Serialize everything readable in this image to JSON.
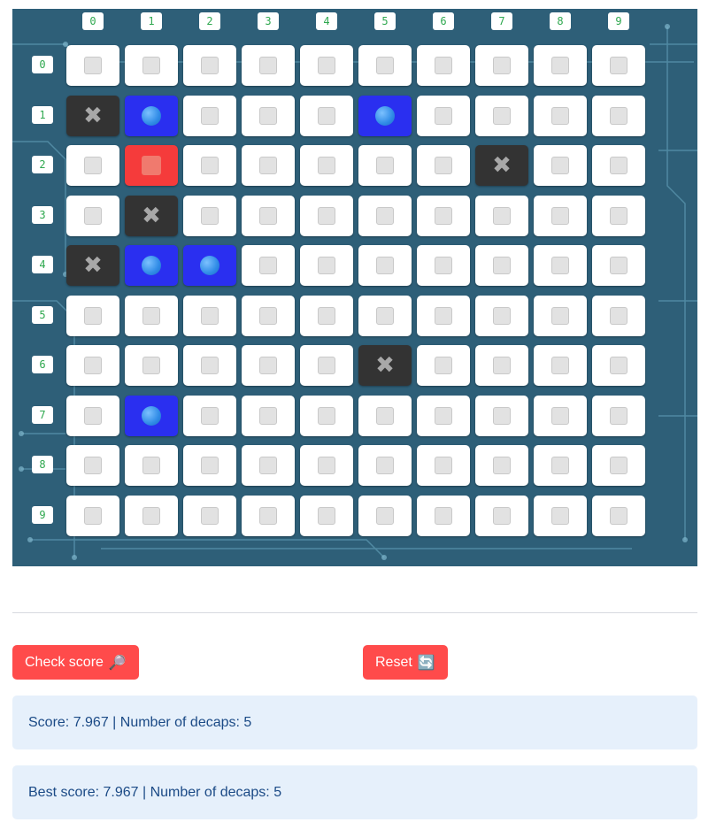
{
  "grid": {
    "columns": [
      "0",
      "1",
      "2",
      "3",
      "4",
      "5",
      "6",
      "7",
      "8",
      "9"
    ],
    "rows": [
      "0",
      "1",
      "2",
      "3",
      "4",
      "5",
      "6",
      "7",
      "8",
      "9"
    ],
    "cells": [
      [
        "empty",
        "empty",
        "empty",
        "empty",
        "empty",
        "empty",
        "empty",
        "empty",
        "empty",
        "empty"
      ],
      [
        "blocked",
        "decap",
        "empty",
        "empty",
        "empty",
        "decap",
        "empty",
        "empty",
        "empty",
        "empty"
      ],
      [
        "empty",
        "target",
        "empty",
        "empty",
        "empty",
        "empty",
        "empty",
        "blocked",
        "empty",
        "empty"
      ],
      [
        "empty",
        "blocked",
        "empty",
        "empty",
        "empty",
        "empty",
        "empty",
        "empty",
        "empty",
        "empty"
      ],
      [
        "blocked",
        "decap",
        "decap",
        "empty",
        "empty",
        "empty",
        "empty",
        "empty",
        "empty",
        "empty"
      ],
      [
        "empty",
        "empty",
        "empty",
        "empty",
        "empty",
        "empty",
        "empty",
        "empty",
        "empty",
        "empty"
      ],
      [
        "empty",
        "empty",
        "empty",
        "empty",
        "empty",
        "blocked",
        "empty",
        "empty",
        "empty",
        "empty"
      ],
      [
        "empty",
        "decap",
        "empty",
        "empty",
        "empty",
        "empty",
        "empty",
        "empty",
        "empty",
        "empty"
      ],
      [
        "empty",
        "empty",
        "empty",
        "empty",
        "empty",
        "empty",
        "empty",
        "empty",
        "empty",
        "empty"
      ],
      [
        "empty",
        "empty",
        "empty",
        "empty",
        "empty",
        "empty",
        "empty",
        "empty",
        "empty",
        "empty"
      ]
    ],
    "icons": {
      "empty": "white-square-icon",
      "decap": "blue-circle-icon",
      "target": "red-square-icon",
      "blocked": "cross-mark-icon"
    },
    "colors": {
      "board_bg": "#2e5f78",
      "decap": "#2a2ff0",
      "target": "#f53b3b",
      "blocked": "#333333"
    }
  },
  "buttons": {
    "check_score_label": "Check score",
    "check_score_icon": "🔎",
    "reset_label": "Reset",
    "reset_icon": "🔄",
    "color": "#ff4b4b"
  },
  "score": {
    "text": "Score: 7.967 | Number of decaps: 5",
    "best_text": "Best score: 7.967 | Number of decaps: 5"
  }
}
